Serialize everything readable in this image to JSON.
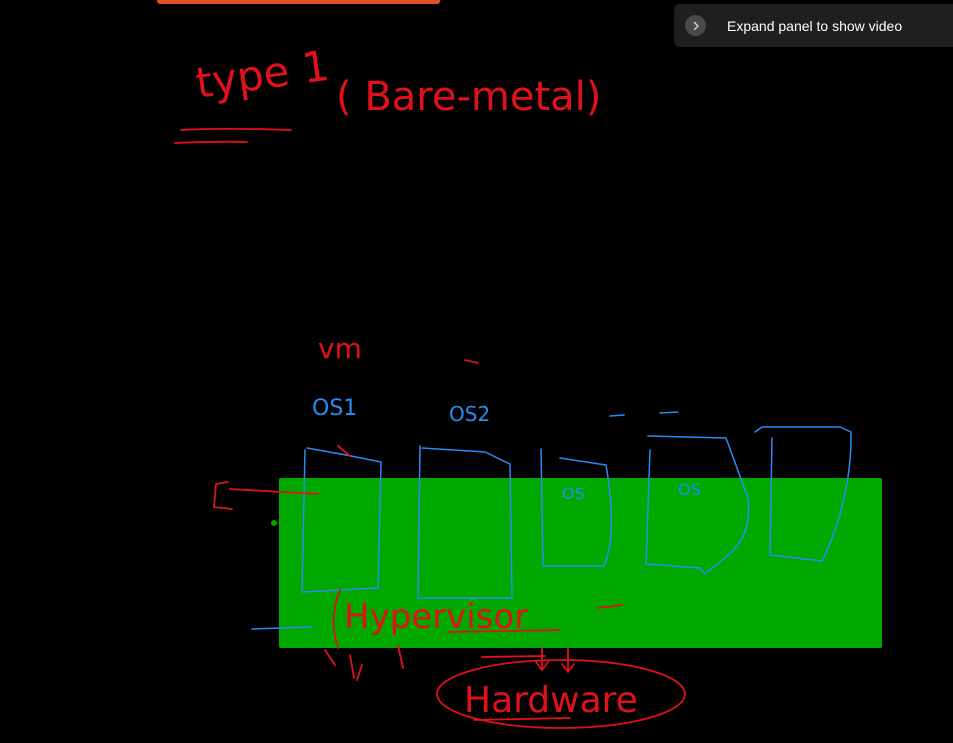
{
  "video_panel": {
    "label": "Expand panel to show video",
    "icon": "chevron-right-icon"
  },
  "colors": {
    "top_bar": "#e0531e",
    "hypervisor_block": "#00a800",
    "ink_red": "#e0111b",
    "ink_blue": "#2a8cf0",
    "panel_bg": "#1f1f1f"
  },
  "whiteboard": {
    "title": "type 1",
    "subtitle": "( Bare-metal)",
    "vm_label": "vm",
    "os1_label": "OS1",
    "os2_label": "OS2",
    "os3_label": "OS",
    "os4_label": "OS",
    "hypervisor_label": "Hypervisor",
    "hardware_label": "Hardware"
  }
}
